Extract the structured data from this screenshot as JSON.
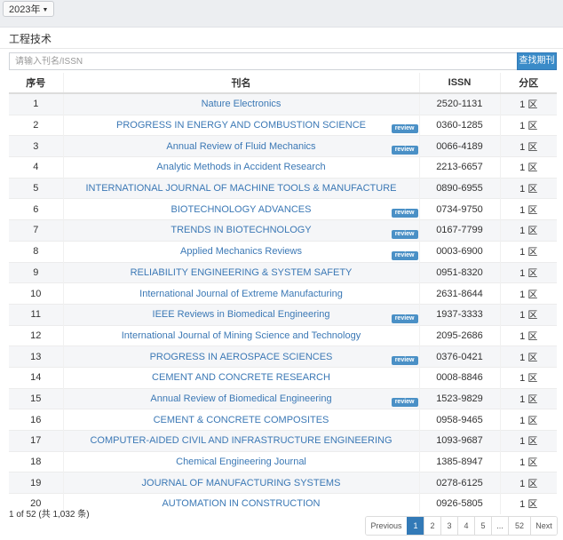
{
  "year_selector": {
    "label": "2023年"
  },
  "section": {
    "title": "工程技术"
  },
  "search": {
    "placeholder": "请输入刊名/ISSN",
    "button_label": "查找期刊"
  },
  "table": {
    "headers": {
      "index": "序号",
      "name": "刊名",
      "issn": "ISSN",
      "zone": "分区"
    },
    "review_label": "review",
    "rows": [
      {
        "index": "1",
        "name": "Nature Electronics",
        "issn": "2520-1131",
        "zone": "1 区",
        "review": false
      },
      {
        "index": "2",
        "name": "PROGRESS IN ENERGY AND COMBUSTION SCIENCE",
        "issn": "0360-1285",
        "zone": "1 区",
        "review": true
      },
      {
        "index": "3",
        "name": "Annual Review of Fluid Mechanics",
        "issn": "0066-4189",
        "zone": "1 区",
        "review": true
      },
      {
        "index": "4",
        "name": "Analytic Methods in Accident Research",
        "issn": "2213-6657",
        "zone": "1 区",
        "review": false
      },
      {
        "index": "5",
        "name": "INTERNATIONAL JOURNAL OF MACHINE TOOLS & MANUFACTURE",
        "issn": "0890-6955",
        "zone": "1 区",
        "review": false
      },
      {
        "index": "6",
        "name": "BIOTECHNOLOGY ADVANCES",
        "issn": "0734-9750",
        "zone": "1 区",
        "review": true
      },
      {
        "index": "7",
        "name": "TRENDS IN BIOTECHNOLOGY",
        "issn": "0167-7799",
        "zone": "1 区",
        "review": true
      },
      {
        "index": "8",
        "name": "Applied Mechanics Reviews",
        "issn": "0003-6900",
        "zone": "1 区",
        "review": true
      },
      {
        "index": "9",
        "name": "RELIABILITY ENGINEERING & SYSTEM SAFETY",
        "issn": "0951-8320",
        "zone": "1 区",
        "review": false
      },
      {
        "index": "10",
        "name": "International Journal of Extreme Manufacturing",
        "issn": "2631-8644",
        "zone": "1 区",
        "review": false
      },
      {
        "index": "11",
        "name": "IEEE Reviews in Biomedical Engineering",
        "issn": "1937-3333",
        "zone": "1 区",
        "review": true
      },
      {
        "index": "12",
        "name": "International Journal of Mining Science and Technology",
        "issn": "2095-2686",
        "zone": "1 区",
        "review": false
      },
      {
        "index": "13",
        "name": "PROGRESS IN AEROSPACE SCIENCES",
        "issn": "0376-0421",
        "zone": "1 区",
        "review": true
      },
      {
        "index": "14",
        "name": "CEMENT AND CONCRETE RESEARCH",
        "issn": "0008-8846",
        "zone": "1 区",
        "review": false
      },
      {
        "index": "15",
        "name": "Annual Review of Biomedical Engineering",
        "issn": "1523-9829",
        "zone": "1 区",
        "review": true
      },
      {
        "index": "16",
        "name": "CEMENT & CONCRETE COMPOSITES",
        "issn": "0958-9465",
        "zone": "1 区",
        "review": false
      },
      {
        "index": "17",
        "name": "COMPUTER-AIDED CIVIL AND INFRASTRUCTURE ENGINEERING",
        "issn": "1093-9687",
        "zone": "1 区",
        "review": false
      },
      {
        "index": "18",
        "name": "Chemical Engineering Journal",
        "issn": "1385-8947",
        "zone": "1 区",
        "review": false
      },
      {
        "index": "19",
        "name": "JOURNAL OF MANUFACTURING SYSTEMS",
        "issn": "0278-6125",
        "zone": "1 区",
        "review": false
      },
      {
        "index": "20",
        "name": "AUTOMATION IN CONSTRUCTION",
        "issn": "0926-5805",
        "zone": "1 区",
        "review": false
      }
    ]
  },
  "summary": {
    "text": "1 of 52 (共 1,032 条)"
  },
  "pagination": {
    "items": [
      {
        "label": "Previous",
        "active": false
      },
      {
        "label": "1",
        "active": true
      },
      {
        "label": "2",
        "active": false
      },
      {
        "label": "3",
        "active": false
      },
      {
        "label": "4",
        "active": false
      },
      {
        "label": "5",
        "active": false
      },
      {
        "label": "...",
        "active": false
      },
      {
        "label": "52",
        "active": false
      },
      {
        "label": "Next",
        "active": false
      }
    ]
  },
  "colors": {
    "accent": "#337ab7",
    "link": "#3b78b5",
    "badge": "#4a90c6",
    "stripe": "#f5f6f8"
  }
}
